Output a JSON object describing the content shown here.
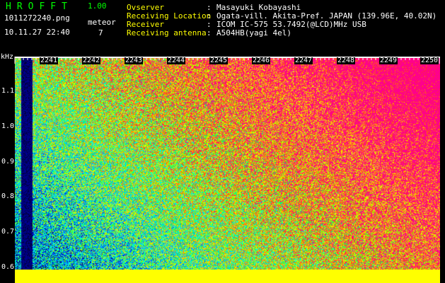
{
  "header": {
    "app_title": "HROFFT",
    "app_version": "1.00",
    "file_name": "1011272240.png",
    "datetime": "10.11.27 22:40",
    "meteor_label": "meteor",
    "meteor_count": "7"
  },
  "info": [
    {
      "key": "Ovserver",
      "value": "Masayuki Kobayashi"
    },
    {
      "key": "Receiving Location",
      "value": "Ogata-vill. Akita-Pref. JAPAN (139.96E, 40.02N)"
    },
    {
      "key": "Receiver",
      "value": "ICOM IC-575 53.7492(@LCD)MHz USB"
    },
    {
      "key": "Receiving antenna",
      "value": "A504HB(yagi 4el)"
    }
  ],
  "spectrogram": {
    "y_unit": "kHz",
    "y_ticks": [
      "1.1",
      "1.0",
      "0.9",
      "0.8",
      "0.7",
      "0.6"
    ],
    "x_ticks": [
      "2241",
      "2242",
      "2243",
      "2244",
      "2245",
      "2246",
      "2247",
      "2248",
      "2249",
      "2250"
    ]
  },
  "colors": {
    "label": "#ffff00",
    "value": "#ffffff",
    "title": "#00ff00"
  }
}
